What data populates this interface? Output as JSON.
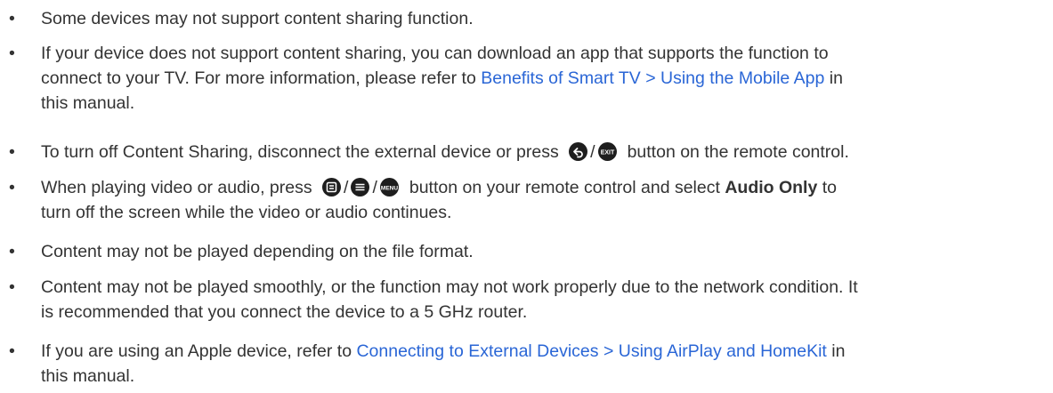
{
  "bullet_char": "•",
  "items": [
    {
      "text": "Some devices may not support content sharing function."
    },
    {
      "line1": "If your device does not support content sharing, you can download an app that supports the function to",
      "line2_pre": "connect to your TV. For more information, please refer to ",
      "line2_link": "Benefits of Smart TV > Using the Mobile App",
      "line2_post": " in",
      "line3": "this manual."
    },
    {
      "pre": "To turn off Content Sharing, disconnect the external device or press",
      "slash": "/",
      "post": "button on the remote control.",
      "icons": [
        "return-icon",
        "exit-icon"
      ]
    },
    {
      "pre": "When playing video or audio, press",
      "slash1": "/",
      "slash2": "/",
      "mid": "button on your remote control and select ",
      "bold": "Audio Only",
      "post": " to",
      "line2": "turn off the screen while the video or audio continues.",
      "icons": [
        "options-icon",
        "menu-lines-icon",
        "menu-icon"
      ]
    },
    {
      "text": "Content may not be played depending on the file format."
    },
    {
      "line1": "Content may not be played smoothly, or the function may not work properly due to the network condition. It",
      "line2": "is recommended that you connect the device to a 5 GHz router."
    },
    {
      "pre": "If you are using an Apple device, refer to ",
      "link": "Connecting to External Devices > Using AirPlay and HomeKit",
      "post": " in",
      "line2": "this manual."
    }
  ]
}
